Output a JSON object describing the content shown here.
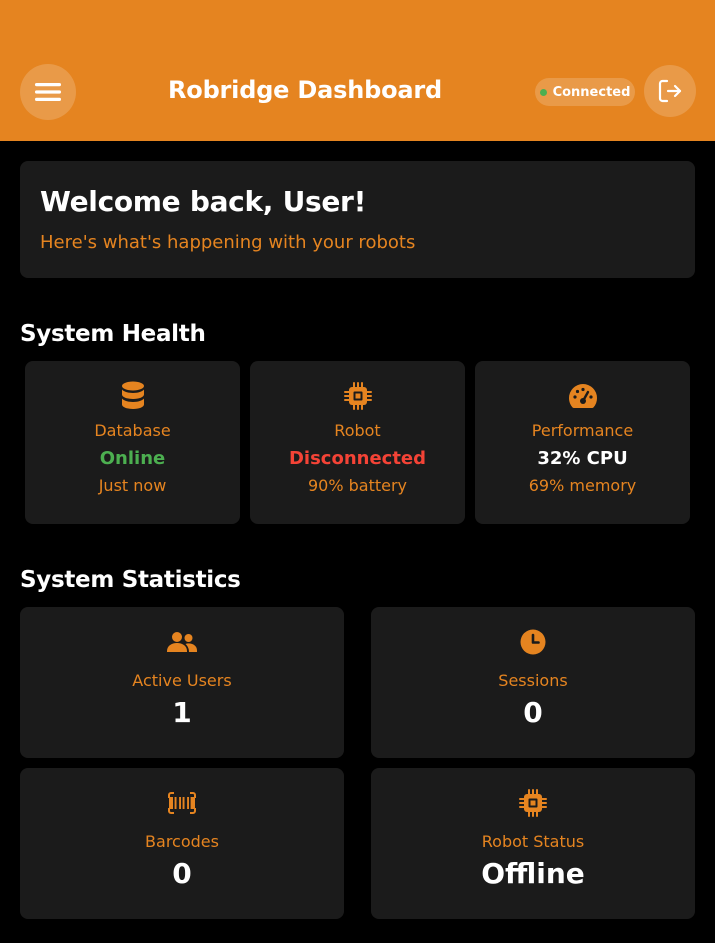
{
  "header": {
    "title": "Robridge Dashboard",
    "connection_status": "Connected",
    "menu_icon": "hamburger-menu-icon",
    "logout_icon": "logout-icon"
  },
  "welcome": {
    "title": "Welcome back, User!",
    "subtitle": "Here's what's happening with your robots"
  },
  "system_health": {
    "title": "System Health",
    "cards": [
      {
        "icon": "database-icon",
        "label": "Database",
        "value": "Online",
        "status": "ok",
        "sub": "Just now"
      },
      {
        "icon": "chip-icon",
        "label": "Robot",
        "value": "Disconnected",
        "status": "bad",
        "sub": "90% battery"
      },
      {
        "icon": "gauge-icon",
        "label": "Performance",
        "value": "32% CPU",
        "status": "neutral",
        "sub": "69% memory"
      }
    ]
  },
  "system_statistics": {
    "title": "System Statistics",
    "cards": [
      {
        "icon": "users-icon",
        "label": "Active Users",
        "value": "1"
      },
      {
        "icon": "clock-icon",
        "label": "Sessions",
        "value": "0"
      },
      {
        "icon": "barcode-icon",
        "label": "Barcodes",
        "value": "0"
      },
      {
        "icon": "chip-icon",
        "label": "Robot Status",
        "value": "Offline",
        "status": "bad"
      }
    ]
  },
  "colors": {
    "accent": "#e58420",
    "background": "#000000",
    "card": "#1b1b1b",
    "success": "#4caf50",
    "danger": "#f44336"
  }
}
